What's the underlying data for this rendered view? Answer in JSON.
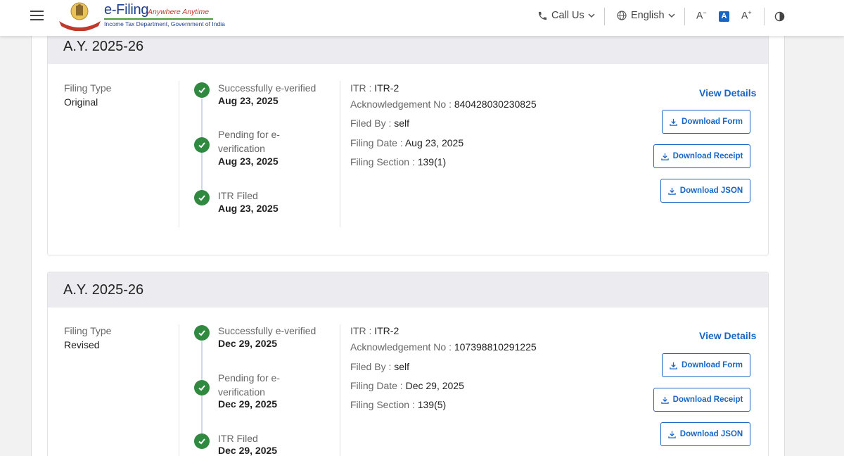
{
  "header": {
    "logo_title": "e-Filing",
    "logo_tagline": "Anywhere Anytime",
    "logo_subtitle": "Income Tax Department, Government of India",
    "call_us": "Call Us",
    "language": "English",
    "font_decrease": "A",
    "font_normal": "A",
    "font_increase": "A"
  },
  "filings": [
    {
      "ay": "A.Y. 2025-26",
      "filing_type_label": "Filing Type",
      "filing_type": "Original",
      "timeline": [
        {
          "title": "Successfully e-verified",
          "date": "Aug 23, 2025"
        },
        {
          "title": "Pending for e-verification",
          "date": "Aug 23, 2025"
        },
        {
          "title": "ITR Filed",
          "date": "Aug 23, 2025"
        }
      ],
      "details": {
        "itr_label": "ITR : ",
        "itr": "ITR-2",
        "ack_label": "Acknowledgement No : ",
        "ack": "840428030230825",
        "filed_by_label": "Filed By : ",
        "filed_by": "self",
        "filing_date_label": "Filing Date : ",
        "filing_date": "Aug 23, 2025",
        "section_label": "Filing Section : ",
        "section": "139(1)"
      },
      "actions": {
        "view_details": "View Details",
        "download_form": "Download Form",
        "download_receipt": "Download Receipt",
        "download_json": "Download JSON"
      }
    },
    {
      "ay": "A.Y. 2025-26",
      "filing_type_label": "Filing Type",
      "filing_type": "Revised",
      "timeline": [
        {
          "title": "Successfully e-verified",
          "date": "Dec 29, 2025"
        },
        {
          "title": "Pending for e-verification",
          "date": "Dec 29, 2025"
        },
        {
          "title": "ITR Filed",
          "date": "Dec 29, 2025"
        }
      ],
      "details": {
        "itr_label": "ITR : ",
        "itr": "ITR-2",
        "ack_label": "Acknowledgement No : ",
        "ack": "107398810291225",
        "filed_by_label": "Filed By : ",
        "filed_by": "self",
        "filing_date_label": "Filing Date : ",
        "filing_date": "Dec 29, 2025",
        "section_label": "Filing Section : ",
        "section": "139(5)"
      },
      "actions": {
        "view_details": "View Details",
        "download_form": "Download Form",
        "download_receipt": "Download Receipt",
        "download_json": "Download JSON"
      }
    }
  ]
}
